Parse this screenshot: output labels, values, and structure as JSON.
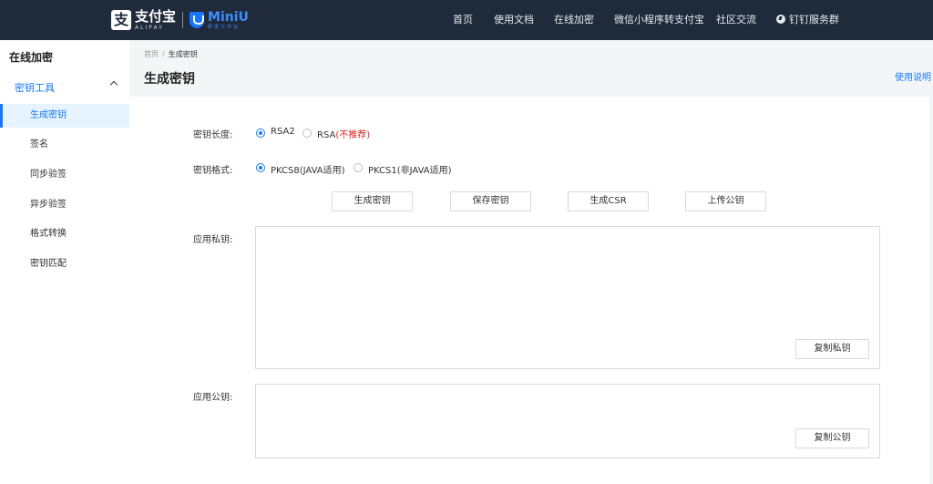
{
  "brand": {
    "alipay_cn": "支付宝",
    "alipay_en": "ALIPAY",
    "miniu_name": "MiniU",
    "miniu_sub": "研发工作台"
  },
  "nav": {
    "items": [
      "首页",
      "使用文档",
      "在线加密",
      "微信小程序转支付宝",
      "社区交流"
    ],
    "dingtalk": "钉钉服务群"
  },
  "sidebar": {
    "title": "在线加密",
    "group_label": "密钥工具",
    "items": [
      "生成密钥",
      "签名",
      "同步验签",
      "异步验签",
      "格式转换",
      "密钥匹配"
    ],
    "active_index": 0
  },
  "breadcrumb": {
    "home": "首页",
    "separator": "/",
    "current": "生成密钥"
  },
  "page": {
    "title": "生成密钥",
    "help": "使用说明"
  },
  "form": {
    "key_length": {
      "label": "密钥长度:",
      "options": [
        "RSA2",
        "RSA"
      ],
      "rsa_warning": "(不推荐)",
      "rsa_warning_close": ")",
      "selected": "RSA2"
    },
    "key_format": {
      "label": "密钥格式:",
      "options": [
        "PKCS8(JAVA适用)",
        "PKCS1(非JAVA适用)"
      ],
      "selected": "PKCS8(JAVA适用)"
    },
    "buttons": [
      "生成密钥",
      "保存密钥",
      "生成CSR",
      "上传公钥"
    ],
    "private_key": {
      "label": "应用私钥:",
      "value": "",
      "copy": "复制私钥"
    },
    "public_key": {
      "label": "应用公钥:",
      "value": "",
      "copy": "复制公钥"
    }
  },
  "colors": {
    "topbar": "#1f2a3a",
    "accent": "#1677ff",
    "warning": "#e02020"
  }
}
